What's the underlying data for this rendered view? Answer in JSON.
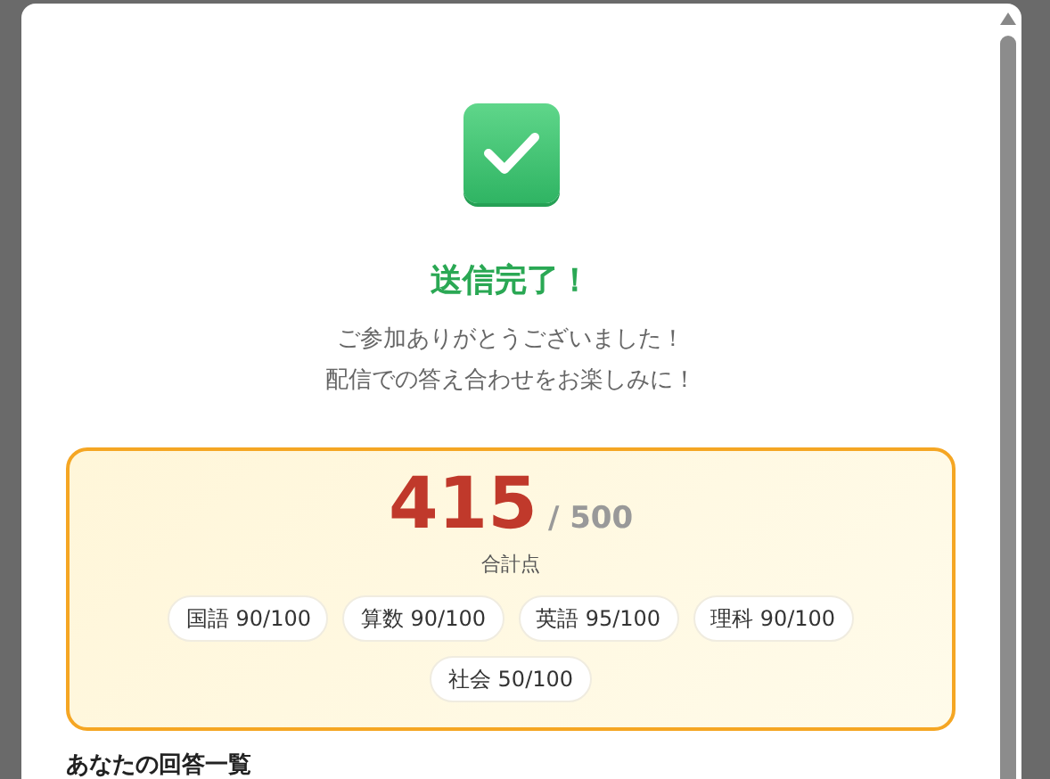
{
  "modal": {
    "title": "送信完了！",
    "messages": [
      "ご参加ありがとうございました！",
      "配信での答え合わせをお楽しみに！"
    ],
    "score": {
      "total": "415",
      "max": "/ 500",
      "label": "合計点",
      "subjects": [
        {
          "label": "国語 90/100"
        },
        {
          "label": "算数 90/100"
        },
        {
          "label": "英語 95/100"
        },
        {
          "label": "理科 90/100"
        },
        {
          "label": "社会 50/100"
        }
      ]
    },
    "next_heading": "あなたの回答一覧"
  }
}
